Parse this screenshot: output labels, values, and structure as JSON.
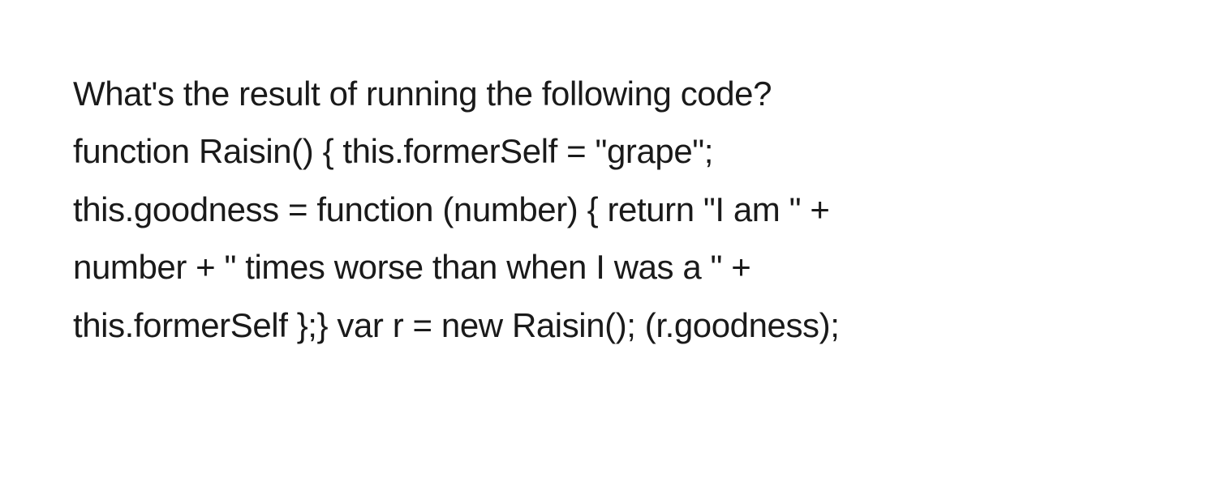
{
  "question": {
    "prompt": "What's the result of running the following code?",
    "code_line1": "function Raisin() { this.formerSelf = \"grape\";",
    "code_line2": "this.goodness = function (number) { return \"I am \" +",
    "code_line3": "number + \" times worse than when I was a \" +",
    "code_line4": "this.formerSelf };} var r = new Raisin(); (r.goodness);"
  }
}
